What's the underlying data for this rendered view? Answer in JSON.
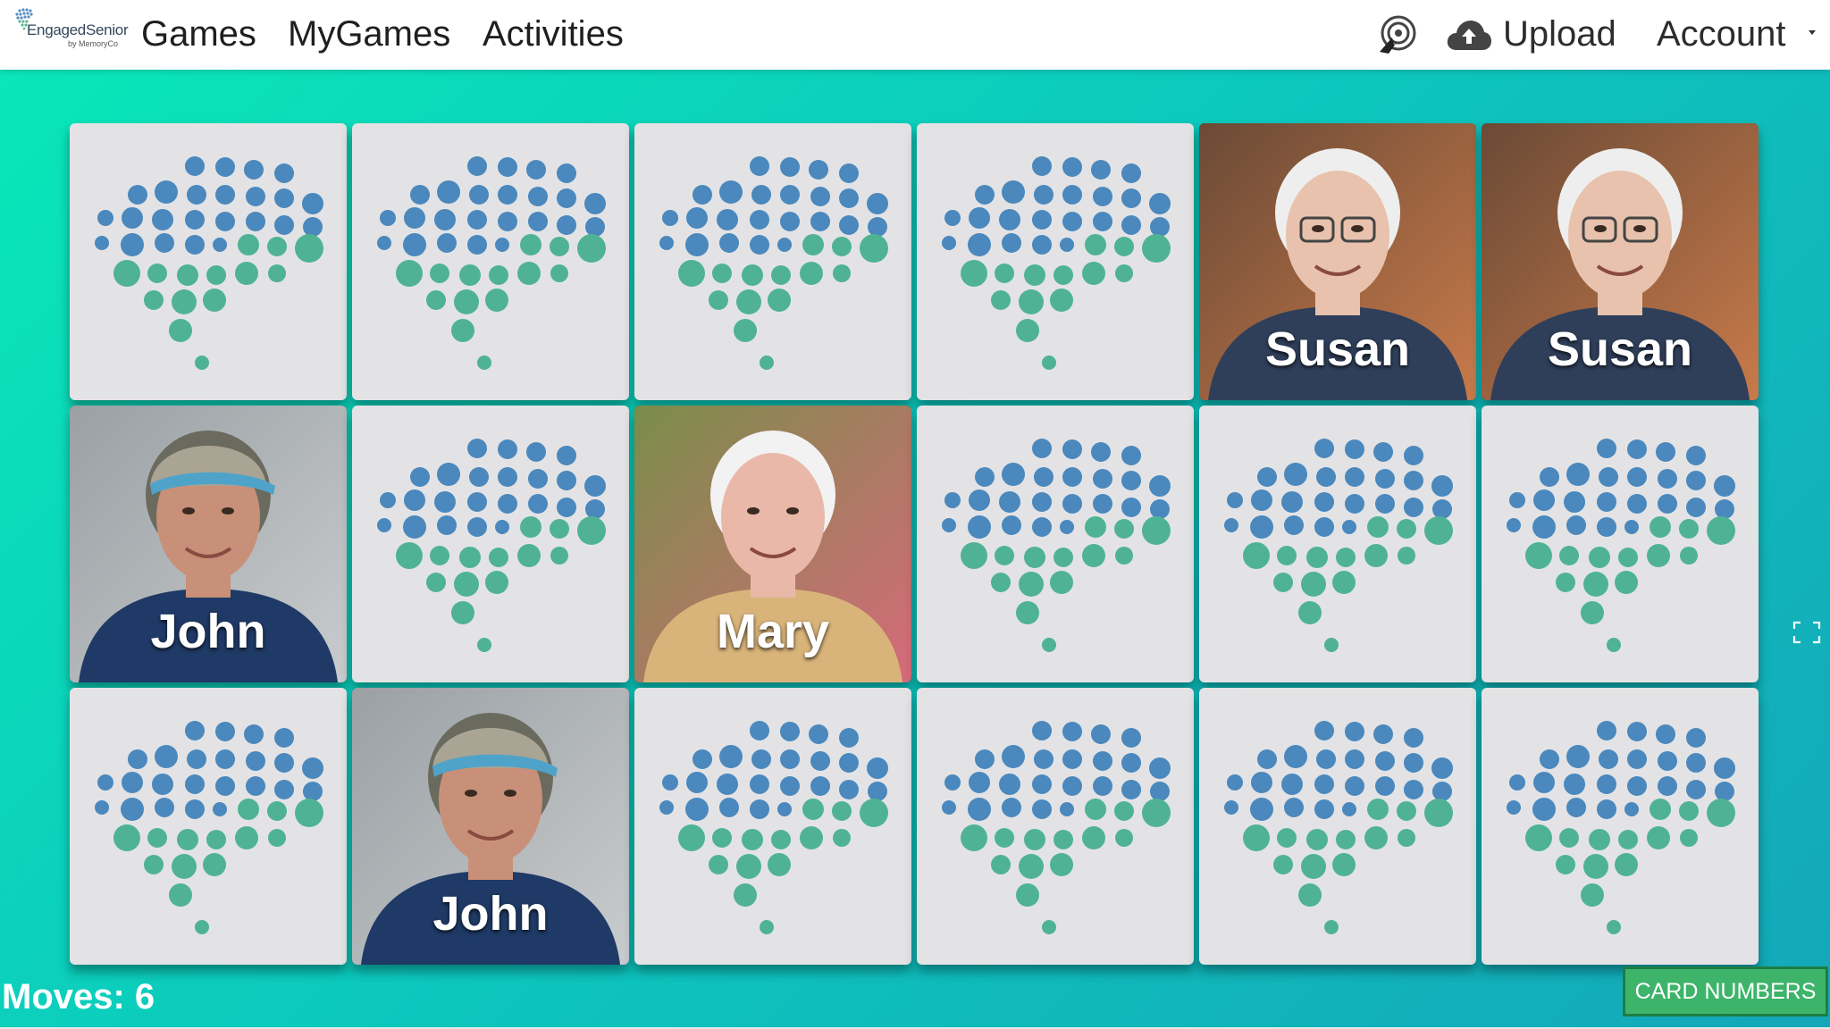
{
  "app": {
    "logo_text": "EngagedSenior",
    "logo_subtext": "by MemoryCo"
  },
  "nav": {
    "links": [
      {
        "label": "Games"
      },
      {
        "label": "MyGames"
      },
      {
        "label": "Activities"
      }
    ],
    "upload_label": "Upload",
    "account_label": "Account"
  },
  "board": {
    "cards": [
      {
        "state": "back"
      },
      {
        "state": "back"
      },
      {
        "state": "back"
      },
      {
        "state": "back"
      },
      {
        "state": "face",
        "name": "Susan"
      },
      {
        "state": "face",
        "name": "Susan"
      },
      {
        "state": "face",
        "name": "John"
      },
      {
        "state": "back"
      },
      {
        "state": "face",
        "name": "Mary"
      },
      {
        "state": "back"
      },
      {
        "state": "back"
      },
      {
        "state": "back"
      },
      {
        "state": "back"
      },
      {
        "state": "face",
        "name": "John"
      },
      {
        "state": "back"
      },
      {
        "state": "back"
      },
      {
        "state": "back"
      },
      {
        "state": "back"
      }
    ]
  },
  "status": {
    "moves_label": "Moves: 6"
  },
  "buttons": {
    "card_numbers": "CARD NUMBERS"
  },
  "colors": {
    "dot_blue": "#4a88bd",
    "dot_green": "#4fb393",
    "card_back": "#e3e3e5",
    "accent_button": "#3db46a",
    "background_start": "#0ae6b8",
    "background_end": "#14a7b9"
  },
  "icons": {
    "cursor_icon": "cursor-click-icon",
    "upload_icon": "cloud-upload-icon",
    "fullscreen_icon": "fullscreen-icon"
  }
}
